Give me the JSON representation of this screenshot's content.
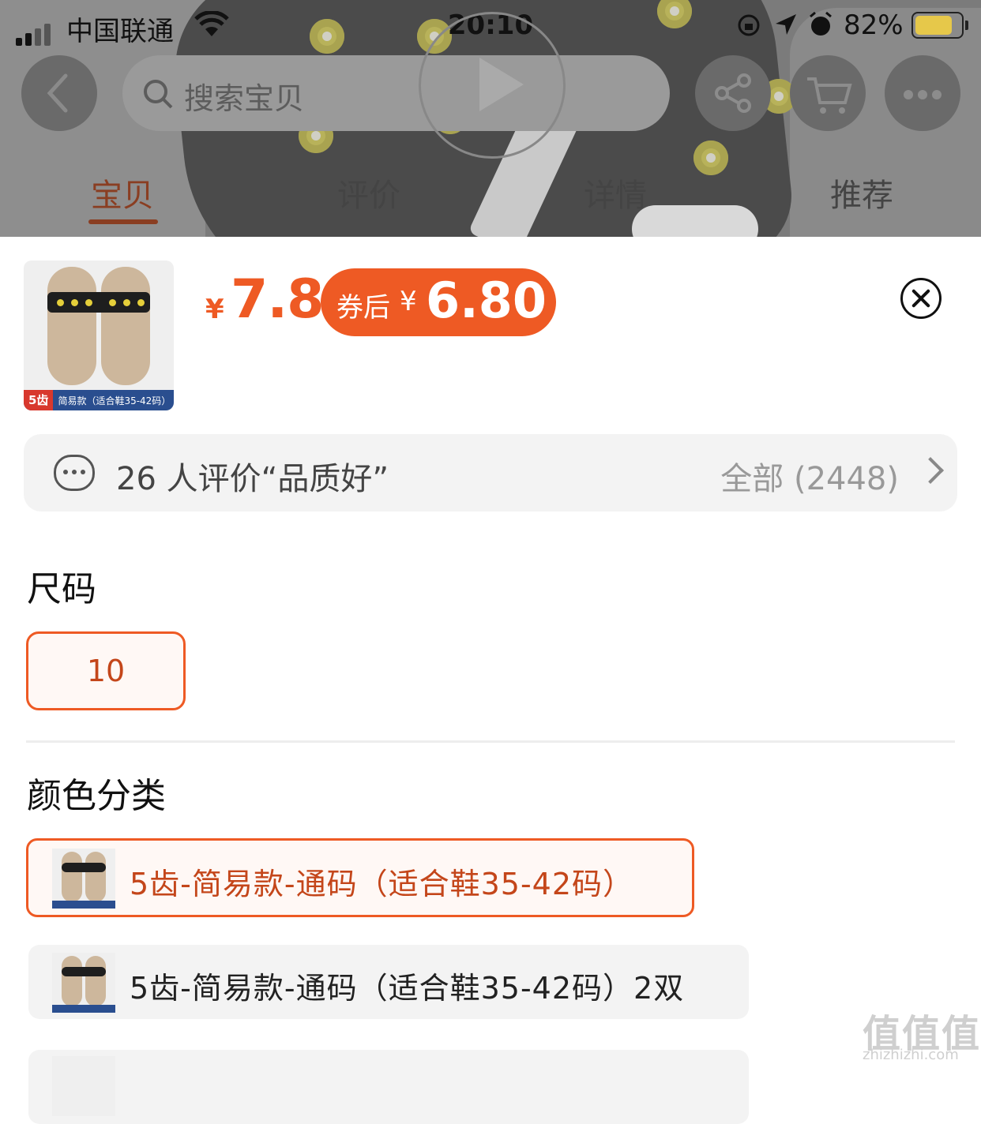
{
  "status": {
    "carrier": "中国联通",
    "time": "20:10",
    "battery": "82%"
  },
  "search": {
    "placeholder": "搜索宝贝"
  },
  "tabs": [
    {
      "label": "宝贝",
      "active": true
    },
    {
      "label": "评价",
      "active": false
    },
    {
      "label": "详情",
      "active": false
    },
    {
      "label": "推荐",
      "active": false
    }
  ],
  "product": {
    "thumb_tag": "5齿",
    "thumb_caption": "简易款（适合鞋35-42码）",
    "currency": "¥",
    "price": "7.8",
    "coupon_label": "券后",
    "coupon_currency": "¥",
    "coupon_price": "6.80"
  },
  "review": {
    "summary": "26 人评价“品质好”",
    "all_label": "全部 (2448)"
  },
  "size": {
    "title": "尺码",
    "options": [
      {
        "label": "10",
        "selected": true
      }
    ]
  },
  "color": {
    "title": "颜色分类",
    "options": [
      {
        "label": "5齿-简易款-通码（适合鞋35-42码）",
        "selected": true
      },
      {
        "label": "5齿-简易款-通码（适合鞋35-42码）2双",
        "selected": false
      }
    ]
  },
  "watermark": {
    "main": "值值值",
    "sub": "zhizhizhi.com"
  },
  "colors": {
    "accent": "#EE5A24",
    "tab_active": "#8A3E22"
  },
  "icons": [
    "back-icon",
    "search-icon",
    "play-icon",
    "share-icon",
    "cart-icon",
    "more-icon",
    "close-icon",
    "comment-icon",
    "chevron-right-icon"
  ]
}
